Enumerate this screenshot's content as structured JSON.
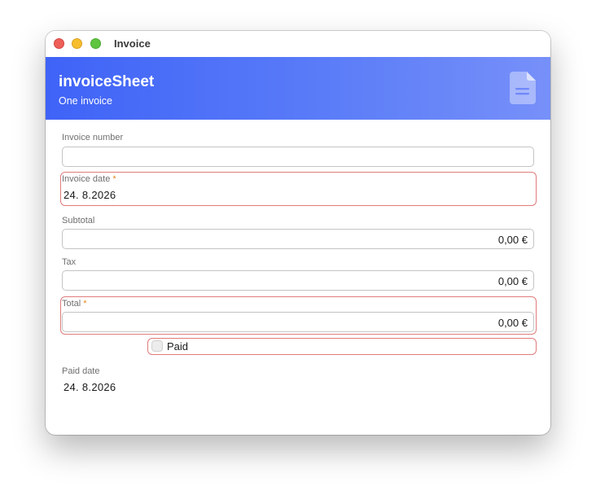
{
  "window": {
    "title": "Invoice"
  },
  "banner": {
    "title": "invoiceSheet",
    "subtitle": "One invoice",
    "icon": "document-icon"
  },
  "form": {
    "invoice_number": {
      "label": "Invoice number",
      "value": ""
    },
    "invoice_date": {
      "label": "Invoice date",
      "required_mark": "*",
      "value": "24.  8.2026"
    },
    "subtotal": {
      "label": "Subtotal",
      "value": "0,00 €"
    },
    "tax": {
      "label": "Tax",
      "value": "0,00 €"
    },
    "total": {
      "label": "Total",
      "required_mark": "*",
      "value": "0,00 €"
    },
    "paid": {
      "label": "Paid",
      "checked": false
    },
    "paid_date": {
      "label": "Paid date",
      "value": "24.  8.2026"
    }
  },
  "colors": {
    "banner_start": "#3f63f7",
    "banner_end": "#7790f9",
    "error_outline": "#e07b7b",
    "required_star": "#e58a1f"
  }
}
